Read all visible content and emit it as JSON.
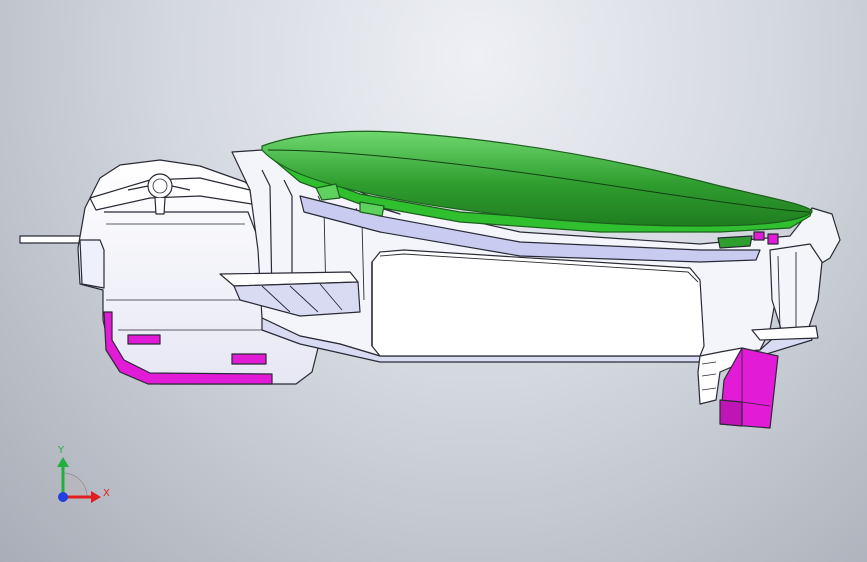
{
  "viewport": {
    "background_top": "#eef0f5",
    "background_bottom": "#a9adb7"
  },
  "model": {
    "body_color": "#ffffff",
    "edge_color": "#2a2a36",
    "shade_color": "#d9dbf3",
    "lid_color": "#2e9e2e",
    "lid_light": "#5ed15e",
    "accent_color": "#e21bd6"
  },
  "triad": {
    "x_label": "X",
    "y_label": "Y",
    "x_color": "#e02020",
    "y_color": "#20b040",
    "z_color": "#2040e0"
  }
}
